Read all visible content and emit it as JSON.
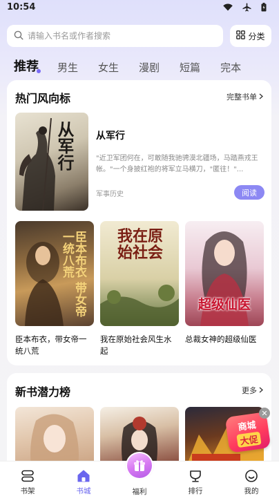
{
  "status_bar": {
    "time": "10:54",
    "icons": [
      "wifi-icon",
      "airplane-icon",
      "battery-icon"
    ]
  },
  "search": {
    "placeholder": "请输入书名或作者搜索",
    "category_label": "分类"
  },
  "tabs": [
    {
      "label": "推荐",
      "active": true
    },
    {
      "label": "男生"
    },
    {
      "label": "女生"
    },
    {
      "label": "漫剧"
    },
    {
      "label": "短篇"
    },
    {
      "label": "完本"
    }
  ],
  "section_hot": {
    "title": "热门风向标",
    "more": "完整书单",
    "featured": {
      "title": "从军行",
      "cover_text": "从军行",
      "description": "\"近卫军团何在，可敢随我驰骋漠北疆场，马踏燕戎王帐。\"一个身披红袍的将军立马横刀，\"匿往！\"...",
      "genre": "军事历史",
      "read_label": "阅读"
    },
    "grid": [
      {
        "title": "臣本布衣，带女帝一统八荒",
        "cover_text": "臣本布衣 带女帝一统八荒"
      },
      {
        "title": "我在原始社会风生水起",
        "cover_text": "我在原始社会"
      },
      {
        "title": "总裁女神的超级仙医",
        "cover_text": "超级仙医"
      }
    ]
  },
  "section_new": {
    "title": "新书潜力榜",
    "more": "更多"
  },
  "promo": {
    "line1": "商城",
    "line2": "大促"
  },
  "bottom_nav": [
    {
      "label": "书架",
      "icon": "bookshelf-icon"
    },
    {
      "label": "书城",
      "icon": "home-icon",
      "active": true
    },
    {
      "label": "福利",
      "icon": "gift-icon"
    },
    {
      "label": "排行",
      "icon": "trophy-icon"
    },
    {
      "label": "我的",
      "icon": "profile-icon"
    }
  ],
  "colors": {
    "accent": "#6a66ee",
    "read_button": "#8c88f3",
    "promo": "#ff3c5d"
  }
}
